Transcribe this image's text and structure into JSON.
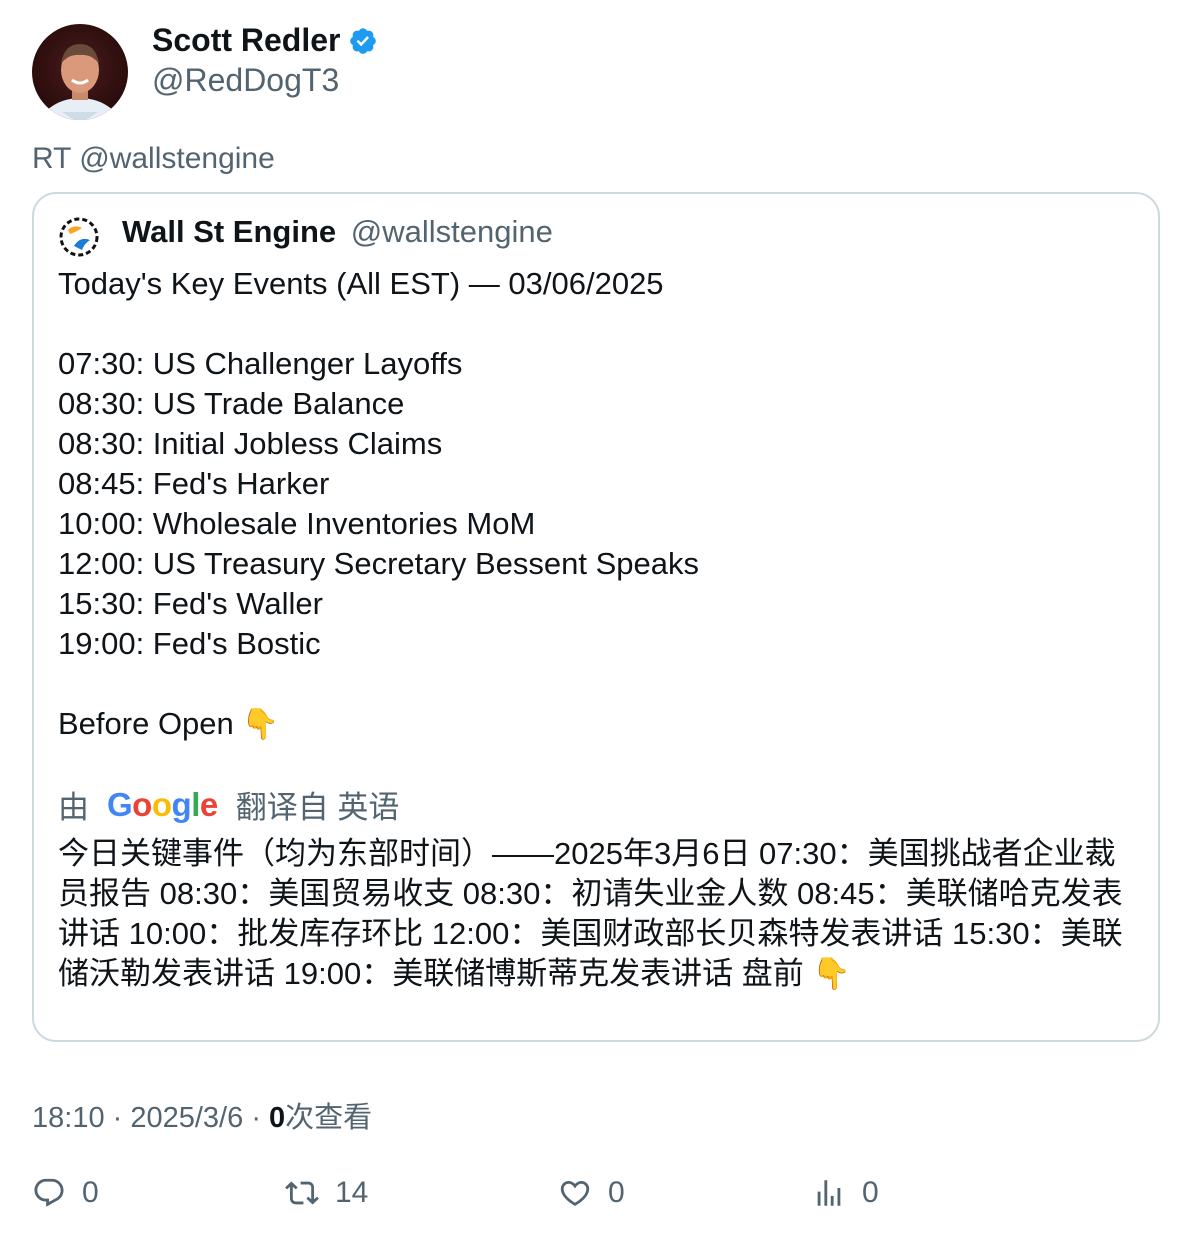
{
  "author": {
    "name": "Scott Redler",
    "handle": "@RedDogT3",
    "verified": true
  },
  "retweet_line": "RT @wallstengine",
  "quoted": {
    "name": "Wall St Engine",
    "handle": "@wallstengine",
    "lines": [
      "Today's Key Events (All EST) — 03/06/2025",
      "",
      "07:30: US Challenger Layoffs",
      "08:30: US Trade Balance",
      "08:30: Initial Jobless Claims",
      "08:45: Fed's Harker",
      "10:00: Wholesale Inventories MoM",
      "12:00: US Treasury Secretary Bessent Speaks",
      "15:30: Fed's Waller",
      "19:00: Fed's Bostic",
      "",
      "Before Open"
    ],
    "emoji": "👇",
    "translation_prefix": "由",
    "translation_suffix": "翻译自 英语",
    "translated_text": "今日关键事件（均为东部时间）——2025年3月6日 07:30：美国挑战者企业裁员报告 08:30：美国贸易收支 08:30：初请失业金人数 08:45：美联储哈克发表讲话 10:00：批发库存环比 12:00：美国财政部长贝森特发表讲话 15:30：美联储沃勒发表讲话 19:00：美联储博斯蒂克发表讲话 盘前 👇"
  },
  "meta": {
    "time": "18:10",
    "date": "2025/3/6",
    "views_count": "0",
    "views_label": "次查看"
  },
  "actions": {
    "reply_count": "0",
    "retweet_count": "14",
    "like_count": "0",
    "views_count": "0"
  },
  "colors": {
    "verified": "#1d9bf0",
    "secondary_text": "#536471",
    "border": "#cfd9de"
  }
}
